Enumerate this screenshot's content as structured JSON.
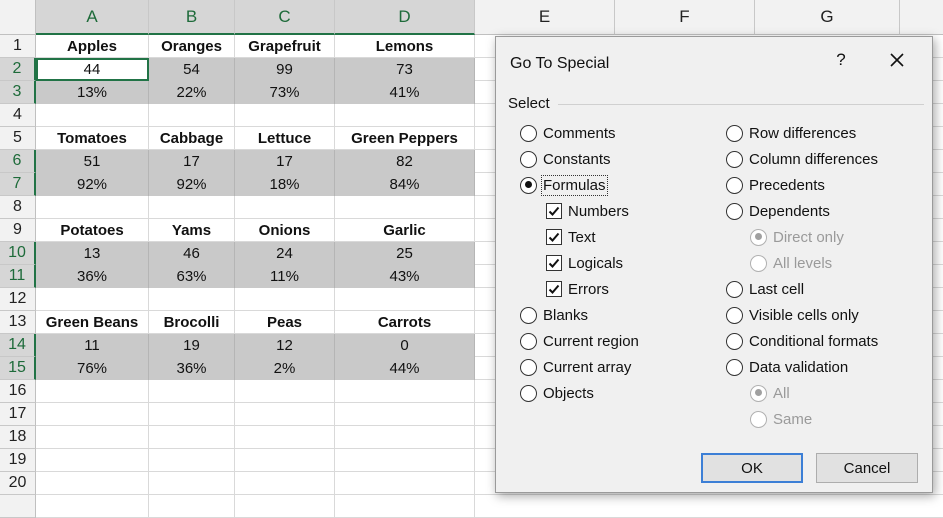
{
  "columns": [
    "A",
    "B",
    "C",
    "D",
    "E",
    "F",
    "G"
  ],
  "rows": [
    "1",
    "2",
    "3",
    "4",
    "5",
    "6",
    "7",
    "8",
    "9",
    "10",
    "11",
    "12",
    "13",
    "14",
    "15",
    "16",
    "17",
    "18",
    "19",
    "20"
  ],
  "grid": {
    "r1": [
      "Apples",
      "Oranges",
      "Grapefruit",
      "Lemons"
    ],
    "r2": [
      "44",
      "54",
      "99",
      "73"
    ],
    "r3": [
      "13%",
      "22%",
      "73%",
      "41%"
    ],
    "r5": [
      "Tomatoes",
      "Cabbage",
      "Lettuce",
      "Green Peppers"
    ],
    "r6": [
      "51",
      "17",
      "17",
      "82"
    ],
    "r7": [
      "92%",
      "92%",
      "18%",
      "84%"
    ],
    "r9": [
      "Potatoes",
      "Yams",
      "Onions",
      "Garlic"
    ],
    "r10": [
      "13",
      "46",
      "24",
      "25"
    ],
    "r11": [
      "36%",
      "63%",
      "11%",
      "43%"
    ],
    "r13": [
      "Green Beans",
      "Brocolli",
      "Peas",
      "Carrots"
    ],
    "r14": [
      "11",
      "19",
      "12",
      "0"
    ],
    "r15": [
      "76%",
      "36%",
      "2%",
      "44%"
    ]
  },
  "dialog": {
    "title": "Go To Special",
    "help": "?",
    "group_label": "Select",
    "left_options": {
      "comments": "Comments",
      "constants": "Constants",
      "formulas": "Formulas",
      "numbers": "Numbers",
      "text": "Text",
      "logicals": "Logicals",
      "errors": "Errors",
      "blanks": "Blanks",
      "current_region": "Current region",
      "current_array": "Current array",
      "objects": "Objects"
    },
    "right_options": {
      "row_differences": "Row differences",
      "column_differences": "Column differences",
      "precedents": "Precedents",
      "dependents": "Dependents",
      "direct_only": "Direct only",
      "all_levels": "All levels",
      "last_cell": "Last cell",
      "visible_cells_only": "Visible cells only",
      "conditional_formats": "Conditional formats",
      "data_validation": "Data validation",
      "all": "All",
      "same": "Same"
    },
    "ok_label": "OK",
    "cancel_label": "Cancel"
  }
}
